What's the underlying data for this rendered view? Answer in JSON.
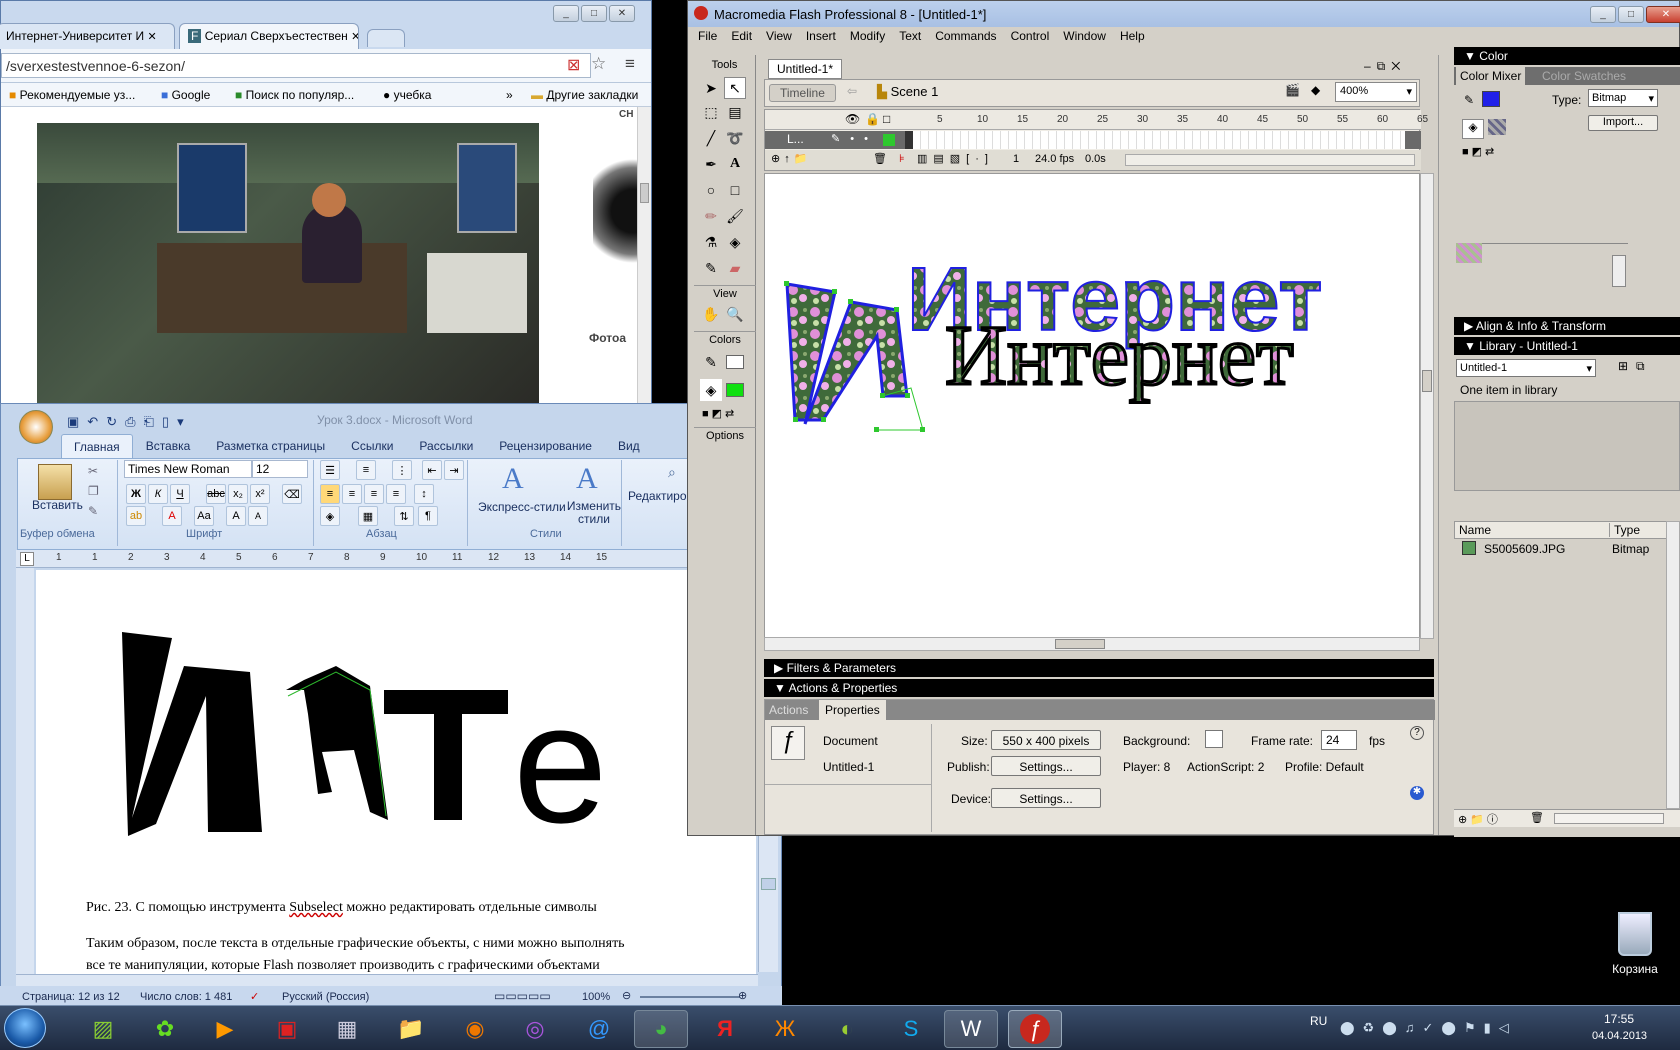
{
  "chrome": {
    "tabs": [
      {
        "label": "Интернет-Университет И",
        "favicon": "F"
      },
      {
        "label": "Сериал Сверхъестествен",
        "favicon": "F"
      }
    ],
    "url": "/sverxestestvennoe-6-sezon/",
    "bookmarks": [
      "Рекомендуемые уз...",
      "Google",
      "Поиск по популяр...",
      "учебка",
      "»",
      "Другие закладки"
    ],
    "side_caption": "Фотоа",
    "side_top": "СН"
  },
  "word": {
    "title": "Урок 3.docx - Microsoft Word",
    "tabs": [
      "Главная",
      "Вставка",
      "Разметка страницы",
      "Ссылки",
      "Рассылки",
      "Рецензирование",
      "Вид"
    ],
    "active_tab": "Главная",
    "font_name": "Times New Roman",
    "font_size": "12",
    "paste_label": "Вставить",
    "group_labels": [
      "Буфер обмена",
      "Шрифт",
      "Абзац",
      "Стили"
    ],
    "styles_label": "Экспресс-стили",
    "change_styles_label": "Изменить стили",
    "editing_label": "Редактирование",
    "figure_text": "Инте",
    "caption_prefix": "Рис. 23. С помощью инструмента ",
    "caption_link": "Subselect",
    "caption_suffix": " можно редактировать отдельные символы",
    "body_line1": "Таким образом, после текста в отдельные графические объекты, с ними можно выполнять",
    "body_line2": "все те манипуляции, которые Flash позволяет производить с графическими объектами",
    "status_page": "Страница: 12 из 12",
    "status_words": "Число слов: 1 481",
    "status_lang": "Русский (Россия)",
    "zoom": "100%",
    "ruler_numbers": [
      "1",
      "1",
      "2",
      "3",
      "4",
      "5",
      "6",
      "7",
      "8",
      "9",
      "10",
      "11",
      "12",
      "13",
      "14",
      "15"
    ]
  },
  "flash": {
    "title": "Macromedia Flash Professional 8 - [Untitled-1*]",
    "menu": [
      "File",
      "Edit",
      "View",
      "Insert",
      "Modify",
      "Text",
      "Commands",
      "Control",
      "Window",
      "Help"
    ],
    "doc_tab": "Untitled-1*",
    "timeline_btn": "Timeline",
    "scene": "Scene 1",
    "zoom": "400%",
    "tools_label": "Tools",
    "view_label": "View",
    "colors_label": "Colors",
    "options_label": "Options",
    "frame_numbers": [
      "5",
      "10",
      "15",
      "20",
      "25",
      "30",
      "35",
      "40",
      "45",
      "50",
      "55",
      "60",
      "65"
    ],
    "layer_name": "L...",
    "frame": "1",
    "fps": "24.0 fps",
    "time": "0.0s",
    "stage_text_top": "Интернет",
    "stage_text_bottom": "Интернет",
    "stage_letter": "И",
    "color_panel": {
      "title": "Color",
      "tab_mixer": "Color Mixer",
      "tab_swatches": "Color Swatches",
      "type_label": "Type:",
      "type_value": "Bitmap",
      "import_btn": "Import..."
    },
    "align_panel": "Align & Info & Transform",
    "library": {
      "title": "Library - Untitled-1",
      "doc_select": "Untitled-1",
      "count": "One item in library",
      "col_name": "Name",
      "col_type": "Type",
      "items": [
        {
          "name": "S5005609.JPG",
          "type": "Bitmap"
        }
      ]
    },
    "filters_bar": "Filters & Parameters",
    "actions_bar": "Actions & Properties",
    "props_tabs": [
      "Actions",
      "Properties"
    ],
    "props": {
      "doc_label": "Document",
      "doc_name": "Untitled-1",
      "size_label": "Size:",
      "size_value": "550 x 400 pixels",
      "bg_label": "Background:",
      "framerate_label": "Frame rate:",
      "framerate_value": "24",
      "fps_unit": "fps",
      "publish_label": "Publish:",
      "settings_btn": "Settings...",
      "player": "Player: 8",
      "actionscript": "ActionScript: 2",
      "profile": "Profile: Default",
      "device_label": "Device:",
      "device_btn": "Settings..."
    }
  },
  "desktop": {
    "recycle_label": "Корзина"
  },
  "taskbar": {
    "lang": "RU",
    "time": "17:55",
    "date": "04.04.2013"
  }
}
